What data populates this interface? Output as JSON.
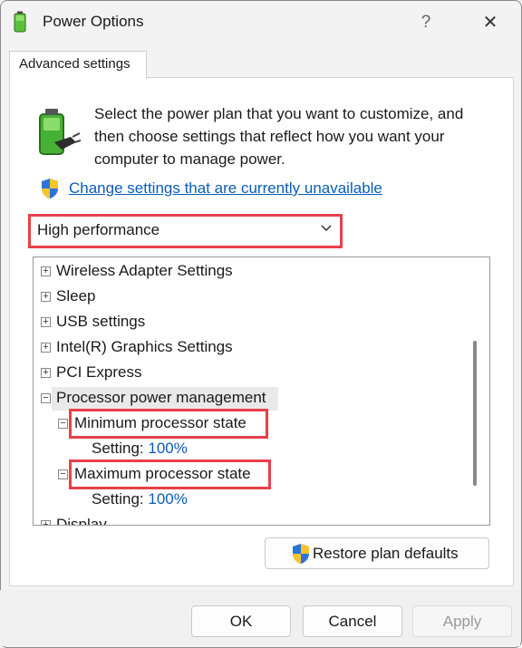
{
  "window": {
    "title": "Power Options",
    "help_label": "?",
    "close_label": "✕"
  },
  "tab": {
    "label": "Advanced settings"
  },
  "description": "Select the power plan that you want to customize, and then choose settings that reflect how you want your computer to manage power.",
  "change_link": "Change settings that are currently unavailable",
  "plan": {
    "selected": "High performance"
  },
  "tree": {
    "items": [
      {
        "label": "Wireless Adapter Settings",
        "expander": "+"
      },
      {
        "label": "Sleep",
        "expander": "+"
      },
      {
        "label": "USB settings",
        "expander": "+"
      },
      {
        "label": "Intel(R) Graphics Settings",
        "expander": "+"
      },
      {
        "label": "PCI Express",
        "expander": "+"
      },
      {
        "label": "Processor power management",
        "expander": "−"
      },
      {
        "label": "Minimum processor state",
        "expander": "−"
      },
      {
        "label": "Maximum processor state",
        "expander": "−"
      },
      {
        "label": "Display",
        "expander": "+"
      }
    ],
    "min_setting": {
      "label": "Setting:",
      "value": "100%"
    },
    "max_setting": {
      "label": "Setting:",
      "value": "100%"
    }
  },
  "buttons": {
    "restore": "Restore plan defaults",
    "ok": "OK",
    "cancel": "Cancel",
    "apply": "Apply"
  },
  "colors": {
    "link": "#0b5cb8",
    "highlight": "#e8404a",
    "window_bg": "#f3f3f3"
  },
  "icons": [
    "power-options-app-icon",
    "battery-plug-icon",
    "uac-shield-icon",
    "chevron-down-icon",
    "close-icon",
    "help-icon"
  ]
}
